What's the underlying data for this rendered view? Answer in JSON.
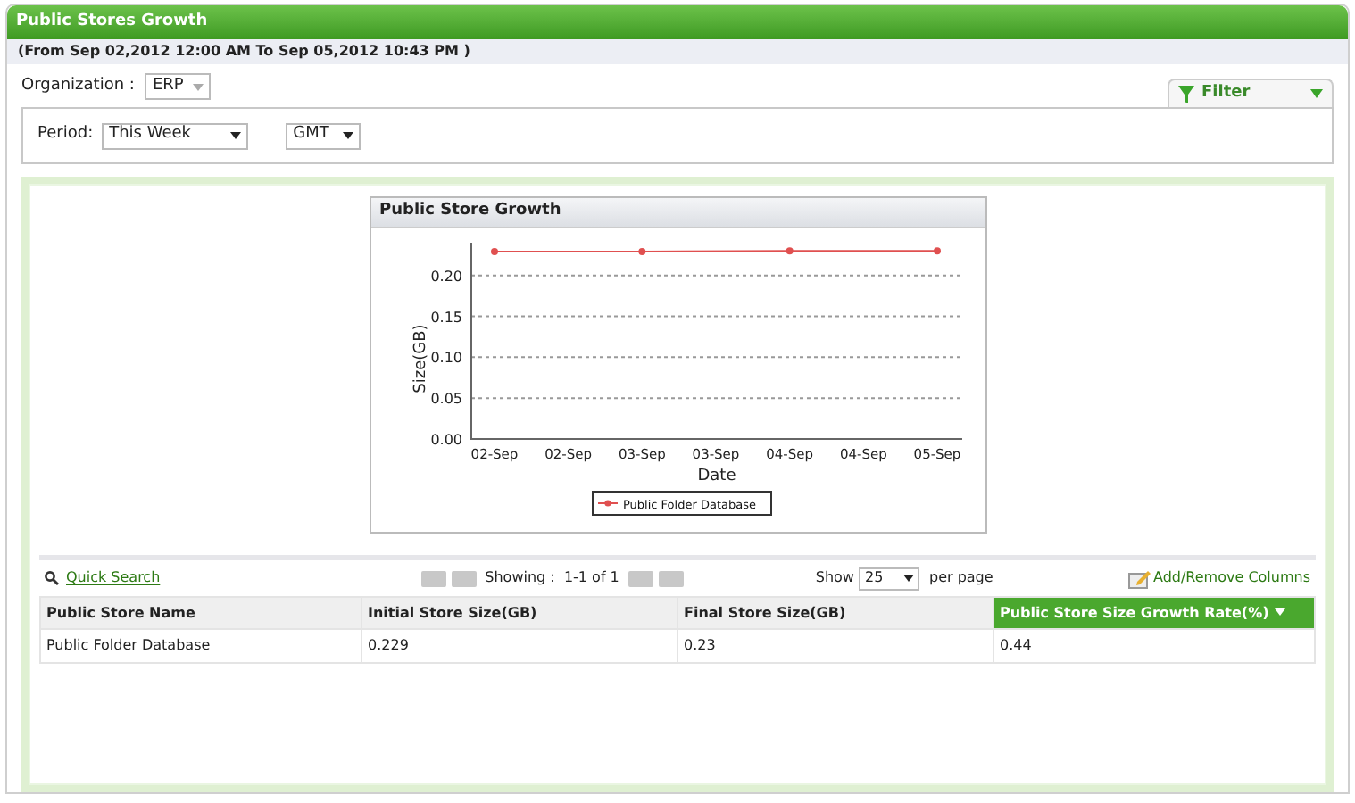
{
  "window": {
    "title": "Public Stores Growth"
  },
  "date_range": "(From Sep 02,2012 12:00 AM To Sep 05,2012 10:43 PM )",
  "filters": {
    "organization_label": "Organization :",
    "organization": "ERP",
    "filter_button": "Filter",
    "period_label": "Period:",
    "period": "This Week",
    "timezone": "GMT"
  },
  "chart": {
    "title": "Public Store Growth",
    "chart_data": {
      "type": "line",
      "xlabel": "Date",
      "ylabel": "Size(GB)",
      "categories": [
        "02-Sep",
        "02-Sep",
        "03-Sep",
        "03-Sep",
        "04-Sep",
        "04-Sep",
        "05-Sep"
      ],
      "series": [
        {
          "name": "Public Folder Database",
          "color": "#e05050",
          "marker": "circle",
          "values": [
            0.229,
            null,
            0.229,
            null,
            0.23,
            null,
            0.23
          ]
        }
      ],
      "ylim": [
        0,
        0.24
      ],
      "grid": true,
      "yticks": [
        {
          "value": 0,
          "label": "0.00"
        },
        {
          "value": 0.05,
          "label": "0.05"
        },
        {
          "value": 0.1,
          "label": "0.10"
        },
        {
          "value": 0.15,
          "label": "0.15"
        },
        {
          "value": 0.2,
          "label": "0.20"
        }
      ]
    }
  },
  "toolbar": {
    "quick_search": "Quick Search",
    "showing": "Showing :  1-1 of 1",
    "show_label": "Show",
    "page_size": "25",
    "per_page": "per page",
    "add_remove": "Add/Remove Columns"
  },
  "table": {
    "columns": [
      {
        "label": "Public Store Name",
        "sorted": false
      },
      {
        "label": "Initial Store Size(GB)",
        "sorted": false
      },
      {
        "label": "Final Store Size(GB)",
        "sorted": false
      },
      {
        "label": "Public Store Size Growth Rate(%)",
        "sorted": true
      }
    ],
    "rows": [
      [
        "Public Folder Database",
        "0.229",
        "0.23",
        "0.44"
      ]
    ]
  }
}
